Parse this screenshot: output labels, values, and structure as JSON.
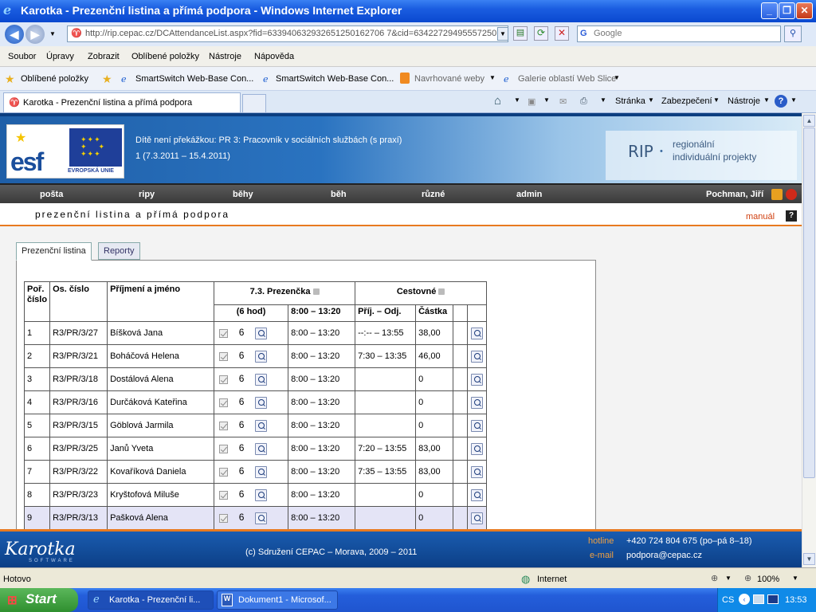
{
  "window": {
    "title": "Karotka - Prezenční listina a přímá podpora - Windows Internet Explorer"
  },
  "address": {
    "url": "http://rip.cepac.cz/DCAttendanceList.aspx?fid=633940632932651250162706 7&cid=634227294955572507",
    "search_placeholder": "Google"
  },
  "menu": [
    "Soubor",
    "Úpravy",
    "Zobrazit",
    "Oblíbené položky",
    "Nástroje",
    "Nápověda"
  ],
  "favorites": {
    "label": "Oblíbené položky",
    "items": [
      "SmartSwitch Web-Base Con...",
      "SmartSwitch Web-Base Con...",
      "Navrhované weby",
      "Galerie oblastí Web Slice"
    ]
  },
  "tab": {
    "title": "Karotka - Prezenční listina a přímá podpora"
  },
  "tools": {
    "page": "Stránka",
    "security": "Zabezpečení",
    "tools": "Nástroje"
  },
  "banner": {
    "title": "Dítě není překážkou: PR 3: Pracovník v sociálních službách (s praxí)",
    "subtitle": "1 (7.3.2011 – 15.4.2011)",
    "esf": "esf",
    "eu": "EVROPSKÁ UNIE",
    "rip": "RIP",
    "rip_line1": "regionální",
    "rip_line2": "individuální projekty"
  },
  "nav": {
    "items": [
      "pošta",
      "ripy",
      "běhy",
      "běh",
      "různé",
      "admin"
    ],
    "user": "Pochman, Jiří"
  },
  "page": {
    "title": "prezenční listina a přímá podpora",
    "manual": "manuál",
    "help": "?"
  },
  "tabs": [
    "Prezenční listina",
    "Reporty"
  ],
  "table": {
    "headers": {
      "num": "Poř. číslo",
      "id": "Os. číslo",
      "name": "Příjmení a jméno",
      "day": "7.3. Prezenčka",
      "travel": "Cestovné",
      "hours": "(6 hod)",
      "time": "8:00 – 13:20",
      "arr": "Příj. – Odj.",
      "amount": "Částka"
    },
    "rows": [
      {
        "n": "1",
        "id": "R3/PR/3/27",
        "name": "Bíšková Jana",
        "h": "6",
        "time": "8:00 – 13:20",
        "travel": "--:-- – 13:55",
        "amt": "38,00"
      },
      {
        "n": "2",
        "id": "R3/PR/3/21",
        "name": "Boháčová Helena",
        "h": "6",
        "time": "8:00 – 13:20",
        "travel": "7:30 – 13:35",
        "amt": "46,00"
      },
      {
        "n": "3",
        "id": "R3/PR/3/18",
        "name": "Dostálová Alena",
        "h": "6",
        "time": "8:00 – 13:20",
        "travel": "",
        "amt": "0"
      },
      {
        "n": "4",
        "id": "R3/PR/3/16",
        "name": "Durčáková Kateřina",
        "h": "6",
        "time": "8:00 – 13:20",
        "travel": "",
        "amt": "0"
      },
      {
        "n": "5",
        "id": "R3/PR/3/15",
        "name": "Göblová Jarmila",
        "h": "6",
        "time": "8:00 – 13:20",
        "travel": "",
        "amt": "0"
      },
      {
        "n": "6",
        "id": "R3/PR/3/25",
        "name": "Janů Yveta",
        "h": "6",
        "time": "8:00 – 13:20",
        "travel": "7:20 – 13:55",
        "amt": "83,00"
      },
      {
        "n": "7",
        "id": "R3/PR/3/22",
        "name": "Kovaříková Daniela",
        "h": "6",
        "time": "8:00 – 13:20",
        "travel": "7:35 – 13:55",
        "amt": "83,00"
      },
      {
        "n": "8",
        "id": "R3/PR/3/23",
        "name": "Kryštofová Miluše",
        "h": "6",
        "time": "8:00 – 13:20",
        "travel": "",
        "amt": "0"
      },
      {
        "n": "9",
        "id": "R3/PR/3/13",
        "name": "Pašková Alena",
        "h": "6",
        "time": "8:00 – 13:20",
        "travel": "",
        "amt": "0"
      }
    ]
  },
  "footer": {
    "logo": "Karotka",
    "logo_sub": "SOFTWARE",
    "copyright": "(c) Sdružení CEPAC – Morava, 2009 – 2011",
    "hotline_label": "hotline",
    "hotline": "+420 724 804 675 (po–pá 8–18)",
    "email_label": "e-mail",
    "email": "podpora@cepac.cz"
  },
  "status": {
    "left": "Hotovo",
    "zone": "Internet",
    "zoom": "100%"
  },
  "taskbar": {
    "start": "Start",
    "tasks": [
      "Karotka - Prezenční li...",
      "Dokument1 - Microsof..."
    ],
    "lang": "CS",
    "time": "13:53"
  }
}
